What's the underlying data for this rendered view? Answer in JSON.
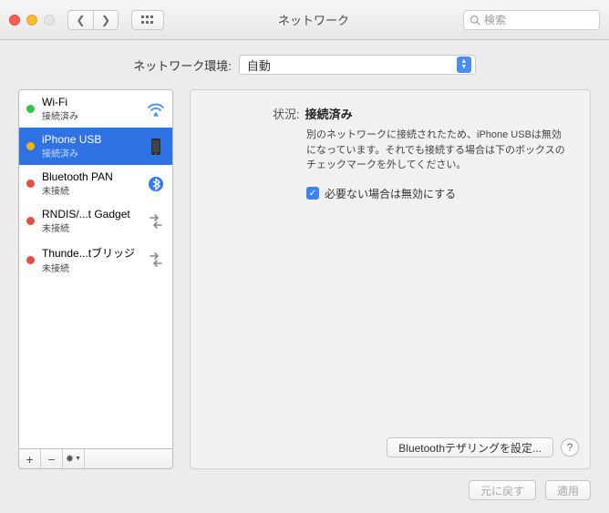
{
  "window": {
    "title": "ネットワーク",
    "search_placeholder": "検索"
  },
  "location": {
    "label": "ネットワーク環境:",
    "value": "自動"
  },
  "sidebar": {
    "items": [
      {
        "name": "Wi-Fi",
        "sub": "接続済み",
        "status": "green",
        "icon": "wifi"
      },
      {
        "name": "iPhone USB",
        "sub": "接続済み",
        "status": "yellow",
        "icon": "phone",
        "selected": true
      },
      {
        "name": "Bluetooth PAN",
        "sub": "未接続",
        "status": "red",
        "icon": "bluetooth"
      },
      {
        "name": "RNDIS/...t Gadget",
        "sub": "未接続",
        "status": "red",
        "icon": "sync"
      },
      {
        "name": "Thunde...tブリッジ",
        "sub": "未接続",
        "status": "red",
        "icon": "sync"
      }
    ],
    "add": "+",
    "remove": "−",
    "gear": "✱"
  },
  "detail": {
    "status_label": "状況:",
    "status_value": "接続済み",
    "description": "別のネットワークに接続されたため、iPhone USBは無効になっています。それでも接続する場合は下のボックスのチェックマークを外してください。",
    "checkbox_label": "必要ない場合は無効にする",
    "checkbox_checked": true,
    "config_button": "Bluetoothテザリングを設定..."
  },
  "footer": {
    "revert": "元に戻す",
    "apply": "適用"
  }
}
